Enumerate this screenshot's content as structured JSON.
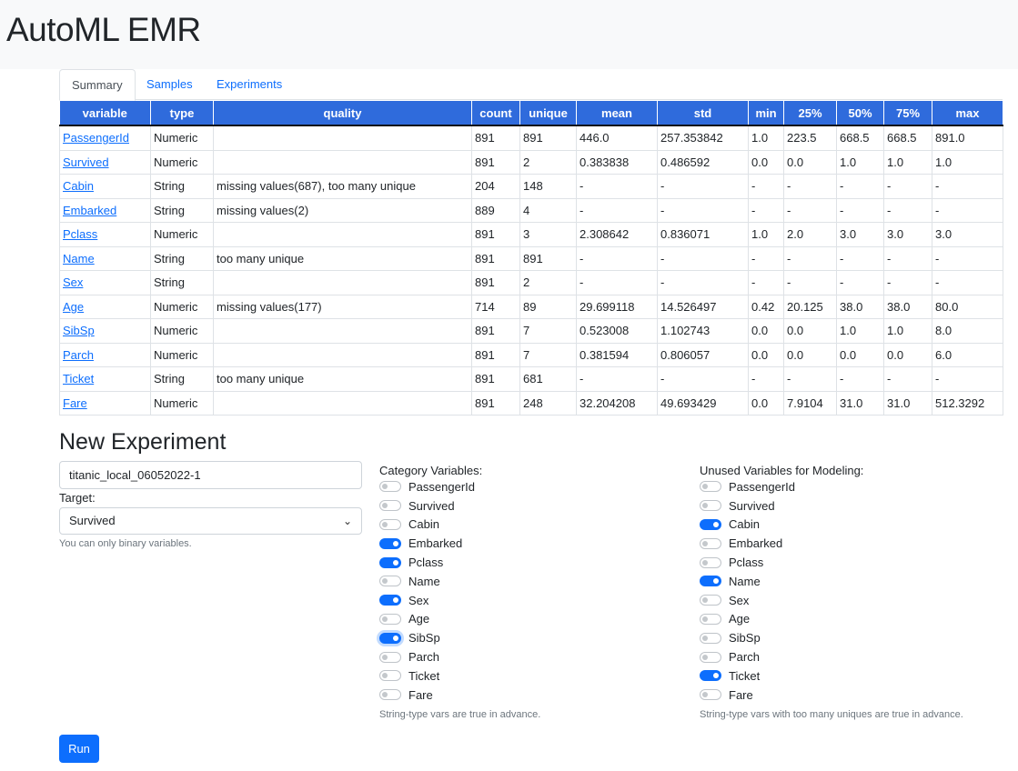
{
  "app": {
    "title": "AutoML EMR"
  },
  "tabs": [
    {
      "label": "Summary",
      "active": true
    },
    {
      "label": "Samples",
      "active": false
    },
    {
      "label": "Experiments",
      "active": false
    }
  ],
  "summary": {
    "headers": [
      "variable",
      "type",
      "quality",
      "count",
      "unique",
      "mean",
      "std",
      "min",
      "25%",
      "50%",
      "75%",
      "max"
    ],
    "rows": [
      [
        "PassengerId",
        "Numeric",
        "",
        "891",
        "891",
        "446.0",
        "257.353842",
        "1.0",
        "223.5",
        "668.5",
        "668.5",
        "891.0"
      ],
      [
        "Survived",
        "Numeric",
        "",
        "891",
        "2",
        "0.383838",
        "0.486592",
        "0.0",
        "0.0",
        "1.0",
        "1.0",
        "1.0"
      ],
      [
        "Cabin",
        "String",
        "missing values(687), too many unique",
        "204",
        "148",
        "-",
        "-",
        "-",
        "-",
        "-",
        "-",
        "-"
      ],
      [
        "Embarked",
        "String",
        "missing values(2)",
        "889",
        "4",
        "-",
        "-",
        "-",
        "-",
        "-",
        "-",
        "-"
      ],
      [
        "Pclass",
        "Numeric",
        "",
        "891",
        "3",
        "2.308642",
        "0.836071",
        "1.0",
        "2.0",
        "3.0",
        "3.0",
        "3.0"
      ],
      [
        "Name",
        "String",
        "too many unique",
        "891",
        "891",
        "-",
        "-",
        "-",
        "-",
        "-",
        "-",
        "-"
      ],
      [
        "Sex",
        "String",
        "",
        "891",
        "2",
        "-",
        "-",
        "-",
        "-",
        "-",
        "-",
        "-"
      ],
      [
        "Age",
        "Numeric",
        "missing values(177)",
        "714",
        "89",
        "29.699118",
        "14.526497",
        "0.42",
        "20.125",
        "38.0",
        "38.0",
        "80.0"
      ],
      [
        "SibSp",
        "Numeric",
        "",
        "891",
        "7",
        "0.523008",
        "1.102743",
        "0.0",
        "0.0",
        "1.0",
        "1.0",
        "8.0"
      ],
      [
        "Parch",
        "Numeric",
        "",
        "891",
        "7",
        "0.381594",
        "0.806057",
        "0.0",
        "0.0",
        "0.0",
        "0.0",
        "6.0"
      ],
      [
        "Ticket",
        "String",
        "too many unique",
        "891",
        "681",
        "-",
        "-",
        "-",
        "-",
        "-",
        "-",
        "-"
      ],
      [
        "Fare",
        "Numeric",
        "",
        "891",
        "248",
        "32.204208",
        "49.693429",
        "0.0",
        "7.9104",
        "31.0",
        "31.0",
        "512.3292"
      ]
    ]
  },
  "experiment": {
    "section_title": "New Experiment",
    "name_value": "titanic_local_06052022-1",
    "target_label": "Target:",
    "target_value": "Survived",
    "target_help": "You can only binary variables.",
    "run_label": "Run"
  },
  "category_vars": {
    "heading": "Category Variables:",
    "help": "String-type vars are true in advance.",
    "items": [
      {
        "label": "PassengerId",
        "on": false
      },
      {
        "label": "Survived",
        "on": false
      },
      {
        "label": "Cabin",
        "on": false
      },
      {
        "label": "Embarked",
        "on": true
      },
      {
        "label": "Pclass",
        "on": true
      },
      {
        "label": "Name",
        "on": false
      },
      {
        "label": "Sex",
        "on": true
      },
      {
        "label": "Age",
        "on": false
      },
      {
        "label": "SibSp",
        "on": true,
        "focused": true
      },
      {
        "label": "Parch",
        "on": false
      },
      {
        "label": "Ticket",
        "on": false
      },
      {
        "label": "Fare",
        "on": false
      }
    ]
  },
  "unused_vars": {
    "heading": "Unused Variables for Modeling:",
    "help": "String-type vars with too many uniques are true in advance.",
    "items": [
      {
        "label": "PassengerId",
        "on": false
      },
      {
        "label": "Survived",
        "on": false
      },
      {
        "label": "Cabin",
        "on": true
      },
      {
        "label": "Embarked",
        "on": false
      },
      {
        "label": "Pclass",
        "on": false
      },
      {
        "label": "Name",
        "on": true
      },
      {
        "label": "Sex",
        "on": false
      },
      {
        "label": "Age",
        "on": false
      },
      {
        "label": "SibSp",
        "on": false
      },
      {
        "label": "Parch",
        "on": false
      },
      {
        "label": "Ticket",
        "on": true
      },
      {
        "label": "Fare",
        "on": false
      }
    ]
  },
  "colors": {
    "accent": "#0d6efd",
    "table_header": "#2f6bdc",
    "header_bg": "#f8f9fa"
  }
}
